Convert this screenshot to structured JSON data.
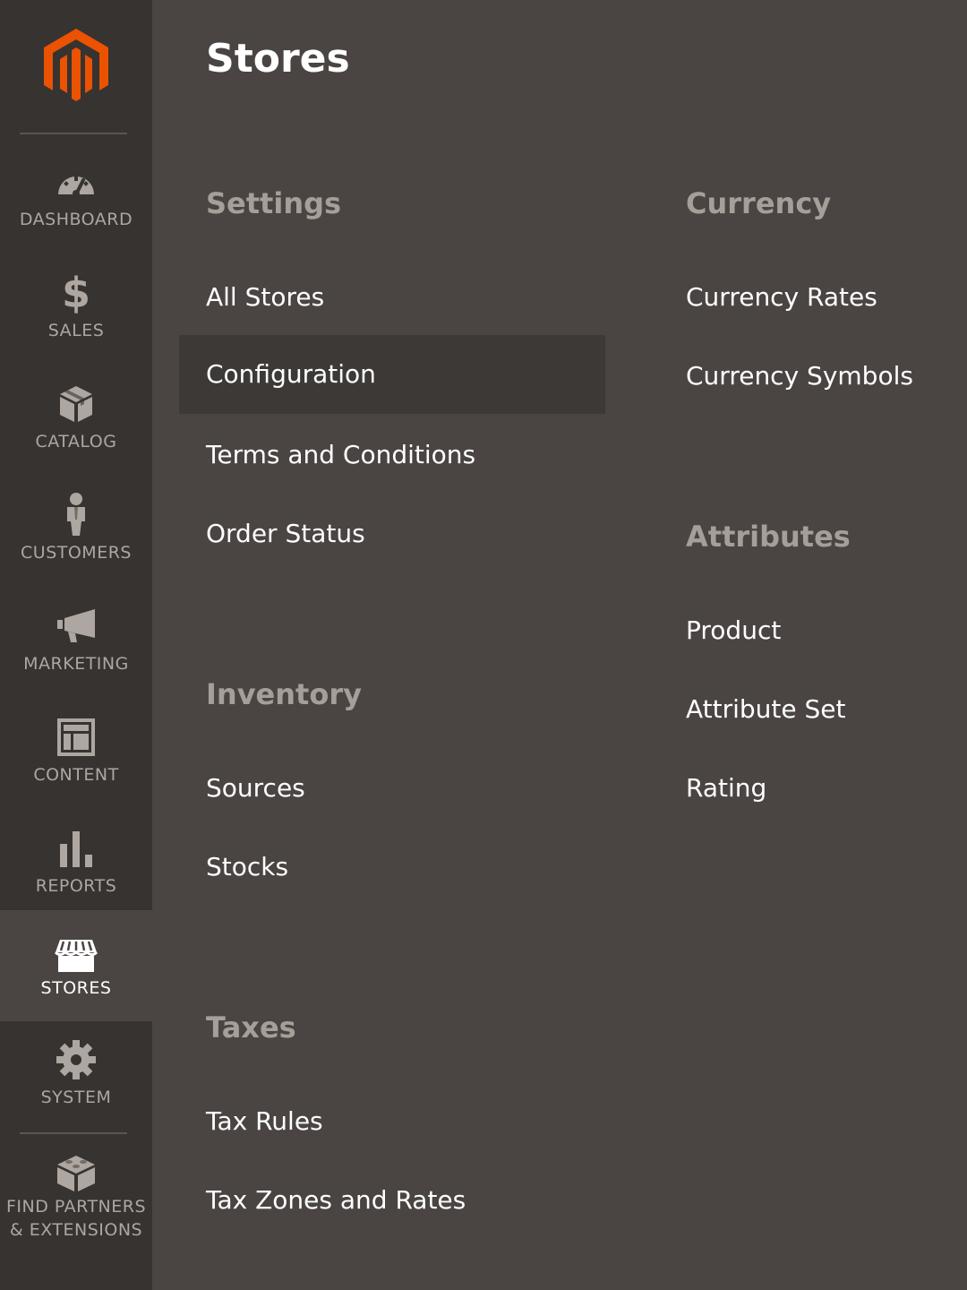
{
  "sidebar": {
    "logo": "magento-logo",
    "items": [
      {
        "label": "DASHBOARD",
        "icon": "dashboard-icon"
      },
      {
        "label": "SALES",
        "icon": "dollar-icon"
      },
      {
        "label": "CATALOG",
        "icon": "box-icon"
      },
      {
        "label": "CUSTOMERS",
        "icon": "person-icon"
      },
      {
        "label": "MARKETING",
        "icon": "megaphone-icon"
      },
      {
        "label": "CONTENT",
        "icon": "layout-icon"
      },
      {
        "label": "REPORTS",
        "icon": "bar-chart-icon"
      },
      {
        "label": "STORES",
        "icon": "storefront-icon",
        "active": true
      },
      {
        "label": "SYSTEM",
        "icon": "gear-icon"
      },
      {
        "label": "FIND PARTNERS\n& EXTENSIONS",
        "label_line1": "FIND PARTNERS",
        "label_line2": "& EXTENSIONS",
        "icon": "blocks-icon"
      }
    ]
  },
  "main": {
    "title": "Stores",
    "sections": {
      "settings": {
        "heading": "Settings",
        "links": [
          "All Stores",
          "Configuration",
          "Terms and Conditions",
          "Order Status"
        ]
      },
      "inventory": {
        "heading": "Inventory",
        "links": [
          "Sources",
          "Stocks"
        ]
      },
      "taxes": {
        "heading": "Taxes",
        "links": [
          "Tax Rules",
          "Tax Zones and Rates"
        ]
      },
      "currency": {
        "heading": "Currency",
        "links": [
          "Currency Rates",
          "Currency Symbols"
        ]
      },
      "attributes": {
        "heading": "Attributes",
        "links": [
          "Product",
          "Attribute Set",
          "Rating"
        ]
      }
    }
  },
  "colors": {
    "sidebar_bg": "#373330",
    "main_bg": "#4a4542",
    "accent": "#eb5202",
    "heading": "#a69f99"
  }
}
